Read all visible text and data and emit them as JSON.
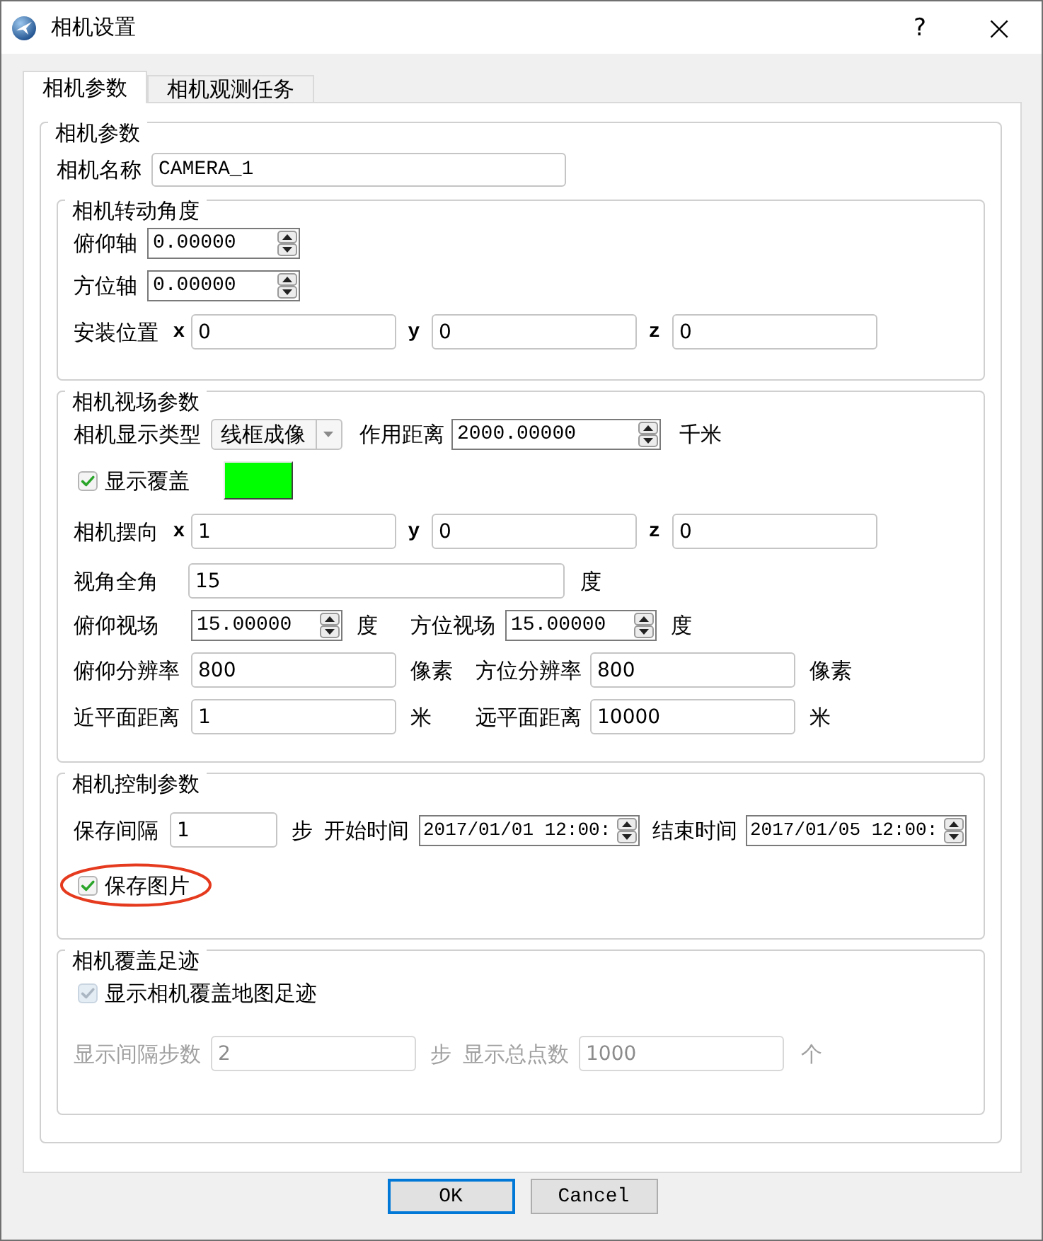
{
  "window": {
    "title": "相机设置",
    "help_button": "?",
    "close_button": "×"
  },
  "tabs": [
    {
      "label": "相机参数",
      "selected": true
    },
    {
      "label": "相机观测任务",
      "selected": false
    }
  ],
  "camera_params": {
    "title": "相机参数",
    "name": {
      "label": "相机名称",
      "value": "CAMERA_1"
    }
  },
  "rotation": {
    "title": "相机转动角度",
    "pitch_axis": {
      "label": "俯仰轴",
      "value": "0.00000"
    },
    "azimuth_axis": {
      "label": "方位轴",
      "value": "0.00000"
    },
    "mount_position": {
      "label": "安装位置",
      "fields": [
        {
          "axis": "x",
          "value": "0"
        },
        {
          "axis": "y",
          "value": "0"
        },
        {
          "axis": "z",
          "value": "0"
        }
      ]
    }
  },
  "field_of_view": {
    "title": "相机视场参数",
    "display_type": {
      "label": "相机显示类型",
      "value": "线框成像"
    },
    "range": {
      "label": "作用距离",
      "value": "2000.00000",
      "unit": "千米"
    },
    "show_coverage": {
      "label": "显示覆盖",
      "checked": true,
      "color": "#00ff00"
    },
    "orientation": {
      "label": "相机摆向",
      "fields": [
        {
          "axis": "x",
          "value": "1"
        },
        {
          "axis": "y",
          "value": "0"
        },
        {
          "axis": "z",
          "value": "0"
        }
      ]
    },
    "full_angle": {
      "label": "视角全角",
      "value": "15",
      "unit": "度"
    },
    "pitch_fov": {
      "label": "俯仰视场",
      "value": "15.00000",
      "unit": "度"
    },
    "azimuth_fov": {
      "label": "方位视场",
      "value": "15.00000",
      "unit": "度"
    },
    "pitch_resolution": {
      "label": "俯仰分辨率",
      "value": "800",
      "unit": "像素"
    },
    "azimuth_resolution": {
      "label": "方位分辨率",
      "value": "800",
      "unit": "像素"
    },
    "near_plane": {
      "label": "近平面距离",
      "value": "1",
      "unit": "米"
    },
    "far_plane": {
      "label": "远平面距离",
      "value": "10000",
      "unit": "米"
    }
  },
  "control": {
    "title": "相机控制参数",
    "save_interval": {
      "label": "保存间隔",
      "value": "1",
      "unit": "步"
    },
    "start_time": {
      "label": "开始时间",
      "value": "2017/01/01 12:00:"
    },
    "end_time": {
      "label": "结束时间",
      "value": "2017/01/05 12:00:"
    },
    "save_images": {
      "label": "保存图片",
      "checked": true,
      "highlighted": true
    }
  },
  "footprint": {
    "title": "相机覆盖足迹",
    "show_footprint": {
      "label": "显示相机覆盖地图足迹",
      "checked": true,
      "disabled": true
    },
    "display_step": {
      "label": "显示间隔步数",
      "value": "2",
      "unit": "步",
      "disabled": true
    },
    "total_points": {
      "label": "显示总点数",
      "value": "1000",
      "unit": "个",
      "disabled": true
    }
  },
  "buttons": [
    {
      "label": "OK",
      "default": true
    },
    {
      "label": "Cancel",
      "default": false
    }
  ]
}
